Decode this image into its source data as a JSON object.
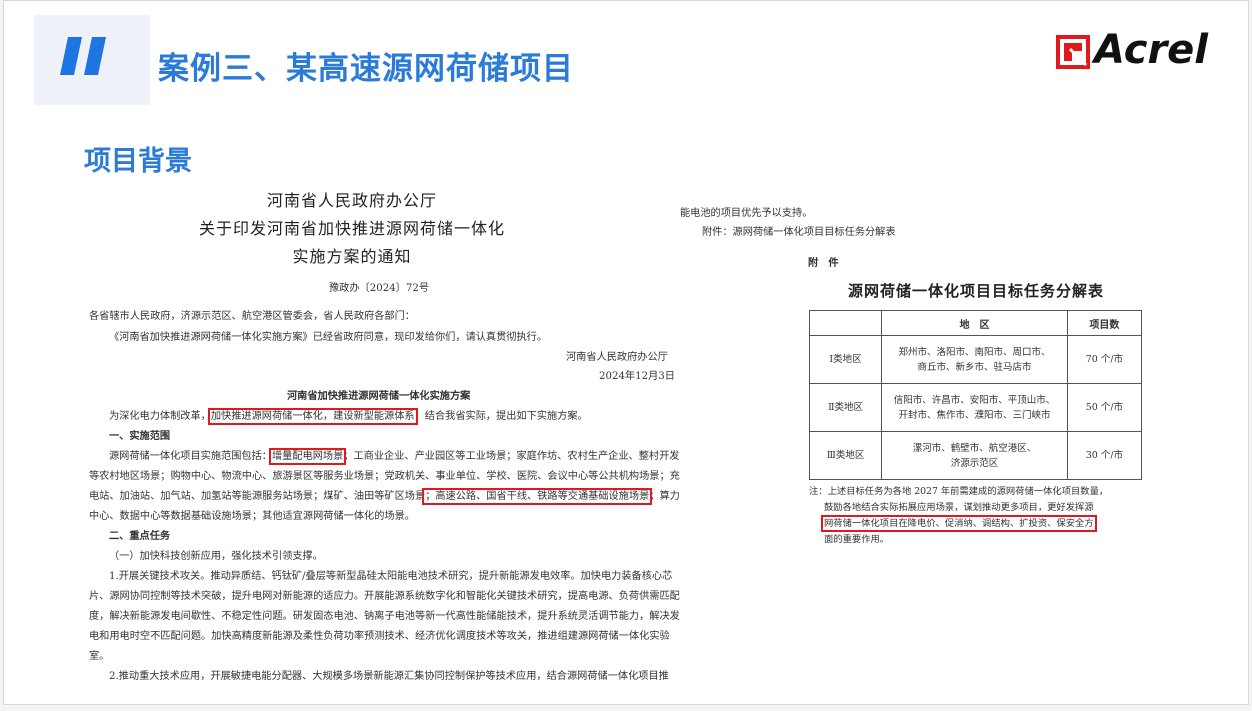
{
  "header": {
    "title": "案例三、某高速源网荷储项目",
    "logo_text": "Acrel",
    "accent_color": "#2b7bd9",
    "logo_red": "#e0191f"
  },
  "section": {
    "title": "项目背景"
  },
  "doc_left": {
    "heading1": "河南省人民政府办公厅",
    "heading2": "关于印发河南省加快推进源网荷储一体化",
    "heading3": "实施方案的通知",
    "doc_no": "豫政办〔2024〕72号",
    "to": "各省辖市人民政府，济源示范区、航空港区管委会，省人民政府各部门：",
    "intro": "《河南省加快推进源网荷储一体化实施方案》已经省政府同意，现印发给你们，请认真贯彻执行。",
    "issuer": "河南省人民政府办公厅",
    "date": "2024年12月3日",
    "plan_title": "河南省加快推进源网荷储一体化实施方案",
    "p1_a": "为深化电力体制改革，",
    "p1_box": "加快推进源网荷储一体化，建设新型能源体系",
    "p1_b": "，结合我省实际，提出如下实施方案。",
    "s1": "一、实施范围",
    "p2_a": "源网荷储一体化项目实施范围包括：",
    "p2_box": "增量配电网场景",
    "p2_b": "；工商业企业、产业园区等工业场景；家庭作坊、农村生产企业、整村开发",
    "p3": "等农村地区场景；购物中心、物流中心、旅游景区等服务业场景；党政机关、事业单位、学校、医院、会议中心等公共机构场景；充",
    "p4_a": "电站、加油站、加气站、加氢站等能源服务站场景；煤矿、油田等矿区场景",
    "p4_box": "；高速公路、国省干线、铁路等交通基础设施场景",
    "p4_b": "；算力",
    "p5": "中心、数据中心等数据基础设施场景；其他适宜源网荷储一体化的场景。",
    "s2": "二、重点任务",
    "s2_1": "（一）加快科技创新应用，强化技术引领支撑。",
    "p6": "1.开展关键技术攻关。推动异质结、钙钛矿/叠层等新型晶硅太阳能电池技术研究，提升新能源发电效率。加快电力装备核心芯",
    "p7": "片、源网协同控制等技术突破，提升电网对新能源的适应力。开展能源系统数字化和智能化关键技术研究，提高电源、负荷供需匹配",
    "p8": "度，解决新能源发电间歇性、不稳定性问题。研发固态电池、钠离子电池等新一代高性能储能技术，提升系统灵活调节能力，解决发",
    "p9": "电和用电时空不匹配问题。加快高精度新能源及柔性负荷功率预测技术、经济优化调度技术等攻关，推进组建源网荷储一体化实验",
    "p10": "室。",
    "p11": "2.推动重大技术应用，开展敏捷电能分配器、大规模多场景新能源汇集协同控制保护等技术应用，结合源网荷储一体化项目推"
  },
  "doc_right": {
    "line1": "能电池的项目优先予以支持。",
    "attach": "附件：源网荷储一体化项目目标任务分解表",
    "fujian": "附　件",
    "table_title": "源网荷储一体化项目目标任务分解表",
    "table": {
      "headers": [
        "地　区",
        "项目数"
      ],
      "rows": [
        {
          "cat": "Ⅰ类地区",
          "region1": "郑州市、洛阳市、南阳市、周口市、",
          "region2": "商丘市、新乡市、驻马店市",
          "count": "70 个/市"
        },
        {
          "cat": "Ⅱ类地区",
          "region1": "信阳市、许昌市、安阳市、平顶山市、",
          "region2": "开封市、焦作市、濮阳市、三门峡市",
          "count": "50 个/市"
        },
        {
          "cat": "Ⅲ类地区",
          "region1": "漯河市、鹤壁市、航空港区、",
          "region2": "济源示范区",
          "count": "30 个/市"
        }
      ]
    },
    "note1": "注：上述目标任务为各地 2027 年前需建成的源网荷储一体化项目数量，",
    "note2": "鼓励各地结合实际拓展应用场景，谋划推动更多项目，更好发挥源",
    "note3": "网荷储一体化项目在降电价、促消纳、调结构、扩投资、保安全方",
    "note4": "面的重要作用。"
  }
}
